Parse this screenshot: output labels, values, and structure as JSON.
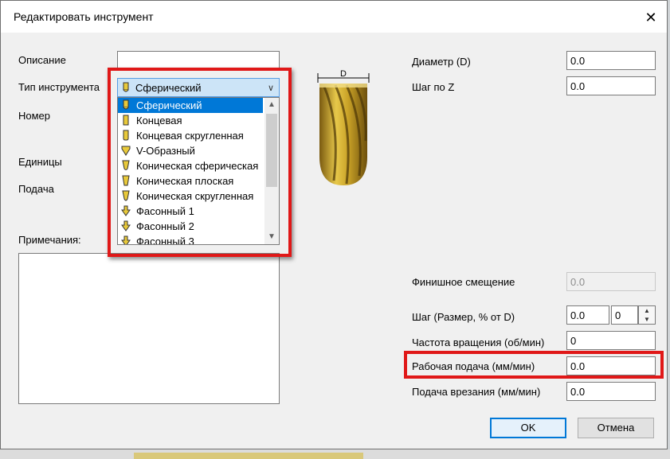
{
  "window": {
    "title": "Редактировать инструмент",
    "close_glyph": "✕"
  },
  "left": {
    "description_label": "Описание",
    "description_value": "",
    "tool_type_label": "Тип инструмента",
    "number_label": "Номер",
    "units_label": "Единицы",
    "feed_label": "Подача",
    "notes_label": "Примечания:"
  },
  "tool_type": {
    "selected": "Сферический",
    "options": [
      {
        "label": "Сферический",
        "icon": "ball-mill-icon"
      },
      {
        "label": "Концевая",
        "icon": "end-mill-icon"
      },
      {
        "label": "Концевая скругленная",
        "icon": "bull-nose-mill-icon"
      },
      {
        "label": "V-Образный",
        "icon": "v-bit-icon"
      },
      {
        "label": "Коническая сферическая",
        "icon": "tapered-ball-icon"
      },
      {
        "label": "Коническая плоская",
        "icon": "tapered-flat-icon"
      },
      {
        "label": "Коническая скругленная",
        "icon": "tapered-round-icon"
      },
      {
        "label": "Фасонный 1",
        "icon": "form-tool-icon"
      },
      {
        "label": "Фасонный 2",
        "icon": "form-tool-icon"
      },
      {
        "label": "Фасонный 3",
        "icon": "form-tool-icon"
      }
    ]
  },
  "image": {
    "dim_label": "D"
  },
  "right": {
    "diameter_label": "Диаметр (D)",
    "diameter_value": "0.0",
    "stepz_label": "Шаг по Z",
    "stepz_value": "0.0",
    "finish_label": "Финишное смещение",
    "finish_value": "0.0",
    "stepover_label": "Шаг (Размер, % от D)",
    "stepover_value": "0.0",
    "stepover_pct": "0",
    "spindle_label": "Частота вращения (об/мин)",
    "spindle_value": "0",
    "feedrate_label": "Рабочая подача (мм/мин)",
    "feedrate_value": "0.0",
    "plunge_label": "Подача врезания (мм/мин)",
    "plunge_value": "0.0"
  },
  "buttons": {
    "ok": "OK",
    "cancel": "Отмена"
  },
  "colors": {
    "highlight": "#e01818",
    "selection": "#0078d7",
    "tool_gold": "#c9a227"
  }
}
